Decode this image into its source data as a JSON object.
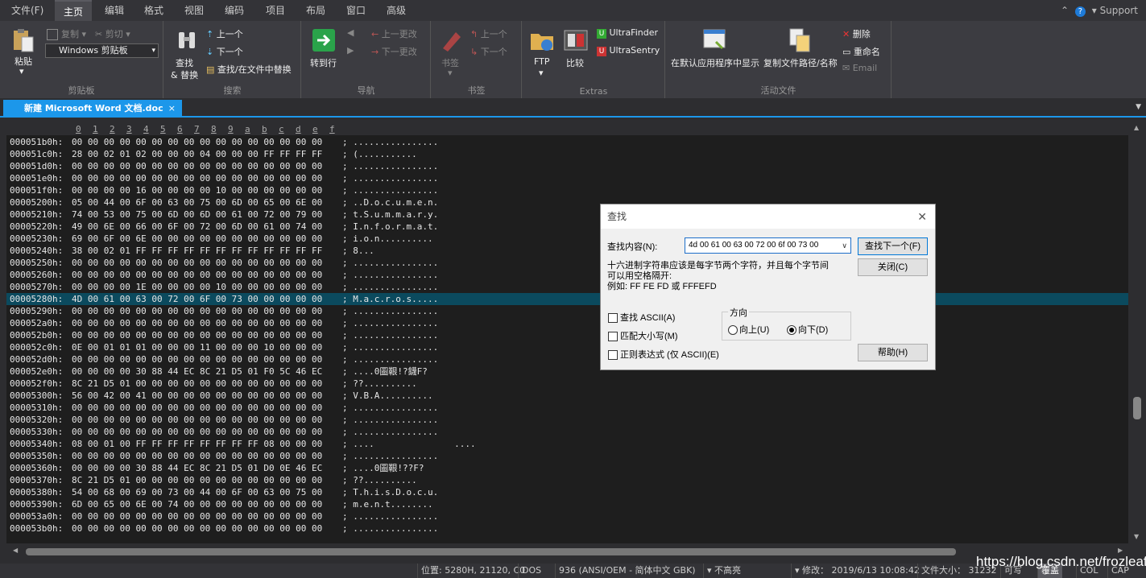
{
  "menu": {
    "items": [
      "文件(F)",
      "主页",
      "编辑",
      "格式",
      "视图",
      "编码",
      "项目",
      "布局",
      "窗口",
      "高级"
    ],
    "active": "主页",
    "support": "Support"
  },
  "ribbon": {
    "clipboard": {
      "paste": "粘贴",
      "copy": "复制",
      "cut": "剪切",
      "clipboard_select": "Windows 剪贴板",
      "label": "剪贴板"
    },
    "search": {
      "find": "查找",
      "replace": "& 替换",
      "up": "上一个",
      "down": "下一个",
      "find_in_files": "查找/在文件中替换",
      "label": "搜索"
    },
    "nav": {
      "goto": "转到行",
      "prev_change": "上一更改",
      "next_change": "下一更改",
      "label": "导航"
    },
    "bookmark": {
      "bookmark": "书签",
      "up": "上一个",
      "down": "下一个",
      "label": "书签"
    },
    "extras": {
      "ftp": "FTP",
      "compare": "比较",
      "ultrafinder": "UltraFinder",
      "ultrasentry": "UltraSentry",
      "label": "Extras"
    },
    "active_file": {
      "show_default": "在默认应用程序中显示",
      "copy_path": "复制文件路径/名称",
      "delete": "删除",
      "rename": "重命名",
      "email": "Email",
      "label": "活动文件"
    }
  },
  "tab": {
    "title": "新建 Microsoft Word 文档.doc",
    "close": "×"
  },
  "hex": {
    "columns": [
      "0",
      "1",
      "2",
      "3",
      "4",
      "5",
      "6",
      "7",
      "8",
      "9",
      "a",
      "b",
      "c",
      "d",
      "e",
      "f"
    ],
    "rows": [
      {
        "addr": "000051b0h:",
        "bytes": "00 00 00 00 00 00 00 00 00 00 00 00 00 00 00 00",
        "ascii": "; ................"
      },
      {
        "addr": "000051c0h:",
        "bytes": "28 00 02 01 02 00 00 00 04 00 00 00 FF FF FF FF",
        "ascii": "; (..........."
      },
      {
        "addr": "000051d0h:",
        "bytes": "00 00 00 00 00 00 00 00 00 00 00 00 00 00 00 00",
        "ascii": "; ................"
      },
      {
        "addr": "000051e0h:",
        "bytes": "00 00 00 00 00 00 00 00 00 00 00 00 00 00 00 00",
        "ascii": "; ................"
      },
      {
        "addr": "000051f0h:",
        "bytes": "00 00 00 00 16 00 00 00 00 10 00 00 00 00 00 00",
        "ascii": "; ................"
      },
      {
        "addr": "00005200h:",
        "bytes": "05 00 44 00 6F 00 63 00 75 00 6D 00 65 00 6E 00",
        "ascii": "; ..D.o.c.u.m.e.n."
      },
      {
        "addr": "00005210h:",
        "bytes": "74 00 53 00 75 00 6D 00 6D 00 61 00 72 00 79 00",
        "ascii": "; t.S.u.m.m.a.r.y."
      },
      {
        "addr": "00005220h:",
        "bytes": "49 00 6E 00 66 00 6F 00 72 00 6D 00 61 00 74 00",
        "ascii": "; I.n.f.o.r.m.a.t."
      },
      {
        "addr": "00005230h:",
        "bytes": "69 00 6F 00 6E 00 00 00 00 00 00 00 00 00 00 00",
        "ascii": "; i.o.n.........."
      },
      {
        "addr": "00005240h:",
        "bytes": "38 00 02 01 FF FF FF FF FF FF FF FF FF FF FF FF",
        "ascii": "; 8..."
      },
      {
        "addr": "00005250h:",
        "bytes": "00 00 00 00 00 00 00 00 00 00 00 00 00 00 00 00",
        "ascii": "; ................"
      },
      {
        "addr": "00005260h:",
        "bytes": "00 00 00 00 00 00 00 00 00 00 00 00 00 00 00 00",
        "ascii": "; ................"
      },
      {
        "addr": "00005270h:",
        "bytes": "00 00 00 00 1E 00 00 00 00 10 00 00 00 00 00 00",
        "ascii": "; ................"
      },
      {
        "addr": "00005280h:",
        "bytes": "4D 00 61 00 63 00 72 00 6F 00 73 00 00 00 00 00",
        "ascii": "; M.a.c.r.o.s....."
      },
      {
        "addr": "00005290h:",
        "bytes": "00 00 00 00 00 00 00 00 00 00 00 00 00 00 00 00",
        "ascii": "; ................"
      },
      {
        "addr": "000052a0h:",
        "bytes": "00 00 00 00 00 00 00 00 00 00 00 00 00 00 00 00",
        "ascii": "; ................"
      },
      {
        "addr": "000052b0h:",
        "bytes": "00 00 00 00 00 00 00 00 00 00 00 00 00 00 00 00",
        "ascii": "; ................"
      },
      {
        "addr": "000052c0h:",
        "bytes": "0E 00 01 01 01 00 00 00 11 00 00 00 10 00 00 00",
        "ascii": "; ................"
      },
      {
        "addr": "000052d0h:",
        "bytes": "00 00 00 00 00 00 00 00 00 00 00 00 00 00 00 00",
        "ascii": "; ................"
      },
      {
        "addr": "000052e0h:",
        "bytes": "00 00 00 00 30 88 44 EC 8C 21 D5 01 F0 5C 46 EC",
        "ascii": "; ....0圖鞎!?鑖F?"
      },
      {
        "addr": "000052f0h:",
        "bytes": "8C 21 D5 01 00 00 00 00 00 00 00 00 00 00 00 00",
        "ascii": "; ??.........."
      },
      {
        "addr": "00005300h:",
        "bytes": "56 00 42 00 41 00 00 00 00 00 00 00 00 00 00 00",
        "ascii": "; V.B.A.........."
      },
      {
        "addr": "00005310h:",
        "bytes": "00 00 00 00 00 00 00 00 00 00 00 00 00 00 00 00",
        "ascii": "; ................"
      },
      {
        "addr": "00005320h:",
        "bytes": "00 00 00 00 00 00 00 00 00 00 00 00 00 00 00 00",
        "ascii": "; ................"
      },
      {
        "addr": "00005330h:",
        "bytes": "00 00 00 00 00 00 00 00 00 00 00 00 00 00 00 00",
        "ascii": "; ................"
      },
      {
        "addr": "00005340h:",
        "bytes": "08 00 01 00 FF FF FF FF FF FF FF FF 08 00 00 00",
        "ascii": "; ....               ...."
      },
      {
        "addr": "00005350h:",
        "bytes": "00 00 00 00 00 00 00 00 00 00 00 00 00 00 00 00",
        "ascii": "; ................"
      },
      {
        "addr": "00005360h:",
        "bytes": "00 00 00 00 30 88 44 EC 8C 21 D5 01 D0 0E 46 EC",
        "ascii": "; ....0圖鞎!??F?"
      },
      {
        "addr": "00005370h:",
        "bytes": "8C 21 D5 01 00 00 00 00 00 00 00 00 00 00 00 00",
        "ascii": "; ??.........."
      },
      {
        "addr": "00005380h:",
        "bytes": "54 00 68 00 69 00 73 00 44 00 6F 00 63 00 75 00",
        "ascii": "; T.h.i.s.D.o.c.u."
      },
      {
        "addr": "00005390h:",
        "bytes": "6D 00 65 00 6E 00 74 00 00 00 00 00 00 00 00 00",
        "ascii": "; m.e.n.t........"
      },
      {
        "addr": "000053a0h:",
        "bytes": "00 00 00 00 00 00 00 00 00 00 00 00 00 00 00 00",
        "ascii": "; ................"
      },
      {
        "addr": "000053b0h:",
        "bytes": "00 00 00 00 00 00 00 00 00 00 00 00 00 00 00 00",
        "ascii": "; ................"
      }
    ],
    "selected_index": 13
  },
  "dialog": {
    "title": "查找",
    "close": "✕",
    "find_label": "查找内容(N):",
    "find_value": "4d 00 61 00 63 00 72 00 6f 00 73 00",
    "hint1": "十六进制字符串应该是每字节两个字符，并且每个字节间",
    "hint2": "可以用空格隔开:",
    "hint3": "例如: FF FE FD 或 FFFEFD",
    "btn_find_next": "查找下一个(F)",
    "btn_close": "关闭(C)",
    "btn_help": "帮助(H)",
    "chk_ascii": "查找 ASCII(A)",
    "chk_case": "匹配大小写(M)",
    "chk_regex": "正则表达式 (仅 ASCII)(E)",
    "direction_label": "方向",
    "dir_up": "向上(U)",
    "dir_down": "向下(D)",
    "dir_selected": "down"
  },
  "status": {
    "position": "位置: 5280H, 21120, C0",
    "lineend": "DOS",
    "encoding": "936   (ANSI/OEM - 简体中文 GBK)",
    "highlight": "不高亮",
    "modified": "修改：  2019/6/13 10:08:42",
    "filesize": "文件大小：  31232",
    "writable": "可写",
    "overwrite": "覆盖",
    "col": "COL",
    "cap": "CAP"
  },
  "watermark": "https://blog.csdn.net/frozleaf"
}
